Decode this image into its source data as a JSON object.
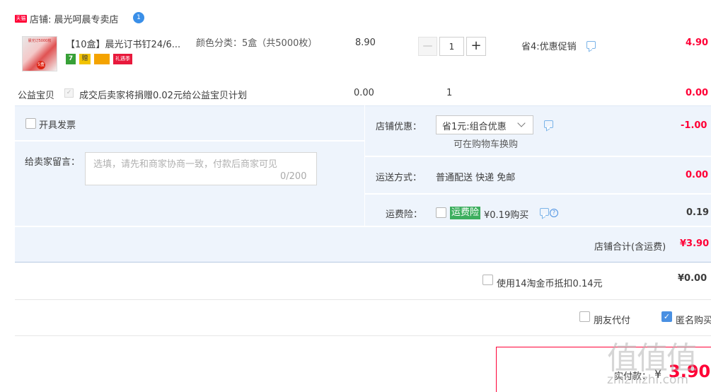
{
  "store": {
    "badge": "天猫",
    "name": "店铺: 晨光呵晨专卖店",
    "ww_count": "1"
  },
  "item": {
    "title": "【10盒】晨光订书钉24/6...",
    "thumb_text": "晨光订5000枚",
    "thumb_badge": "5盒",
    "service_badges": [
      "7",
      "赠",
      "",
      "礼遇季"
    ],
    "sku": "颜色分类：5盒（共5000枚）",
    "price": "8.90",
    "qty": "1",
    "qty_minus": "—",
    "qty_plus": "+",
    "promo": "省4:优惠促销",
    "total": "4.90"
  },
  "charity": {
    "label": "公益宝贝",
    "text": "成交后卖家将捐赠0.02元给公益宝贝计划",
    "price": "0.00",
    "qty": "1",
    "total": "0.00"
  },
  "invoice": {
    "label": "开具发票"
  },
  "memo": {
    "label": "给卖家留言：",
    "placeholder": "选填，请先和商家协商一致，付款后商家可见",
    "count": "0/200"
  },
  "shop_discount": {
    "label": "店铺优惠：",
    "selected": "省1元:组合优惠",
    "note": "可在购物车换购",
    "value": "-1.00"
  },
  "shipping": {
    "label": "运送方式：",
    "method": "普通配送 快递 免邮",
    "value": "0.00"
  },
  "insurance": {
    "label": "运费险：",
    "badge": "运费险",
    "price": "¥0.19购买",
    "value": "0.19"
  },
  "subtotal": {
    "label": "店铺合计(含运费)",
    "value": "¥3.90"
  },
  "coins": {
    "label": "使用14淘金币抵扣0.14元",
    "value": "¥0.00"
  },
  "friend_pay": {
    "label": "朋友代付"
  },
  "anonymous": {
    "label": "匿名购买"
  },
  "pay": {
    "label": "实付款：",
    "currency": "¥",
    "value": "3.90"
  },
  "watermark": {
    "logo": "值值值",
    "url": "zhizhizhi.com"
  },
  "colors": {
    "accent_red": "#ff0036",
    "panel_blue": "#eef4fc",
    "insurance_green": "#3cae5e",
    "link_blue": "#4a90e2"
  }
}
